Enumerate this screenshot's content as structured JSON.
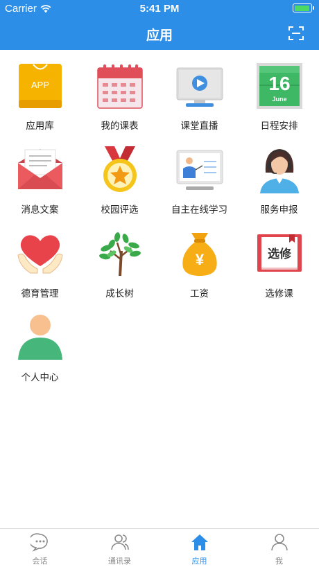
{
  "status_bar": {
    "carrier": "Carrier",
    "time": "5:41 PM"
  },
  "header": {
    "title": "应用"
  },
  "apps": [
    {
      "label": "应用库",
      "icon": "app-store-icon",
      "badge": "APP"
    },
    {
      "label": "我的课表",
      "icon": "calendar-icon"
    },
    {
      "label": "课堂直播",
      "icon": "live-class-icon"
    },
    {
      "label": "日程安排",
      "icon": "schedule-icon",
      "day": "16",
      "month": "June"
    },
    {
      "label": "消息文案",
      "icon": "mail-icon"
    },
    {
      "label": "校园评选",
      "icon": "medal-icon"
    },
    {
      "label": "自主在线学习",
      "icon": "online-learning-icon"
    },
    {
      "label": "服务申报",
      "icon": "service-agent-icon"
    },
    {
      "label": "德育管理",
      "icon": "heart-hands-icon"
    },
    {
      "label": "成长树",
      "icon": "tree-icon"
    },
    {
      "label": "工资",
      "icon": "money-bag-icon",
      "symbol": "¥"
    },
    {
      "label": "选修课",
      "icon": "elective-book-icon",
      "book_text": "选修"
    },
    {
      "label": "个人中心",
      "icon": "person-icon"
    }
  ],
  "tabbar": {
    "items": [
      {
        "label": "会话",
        "icon": "chat-icon"
      },
      {
        "label": "通讯录",
        "icon": "contacts-icon"
      },
      {
        "label": "应用",
        "icon": "home-icon",
        "active": true
      },
      {
        "label": "我",
        "icon": "profile-icon"
      }
    ]
  },
  "colors": {
    "primary": "#2d8ee8",
    "active_tab": "#2d8ee8",
    "inactive_tab": "#8a8a8a"
  }
}
